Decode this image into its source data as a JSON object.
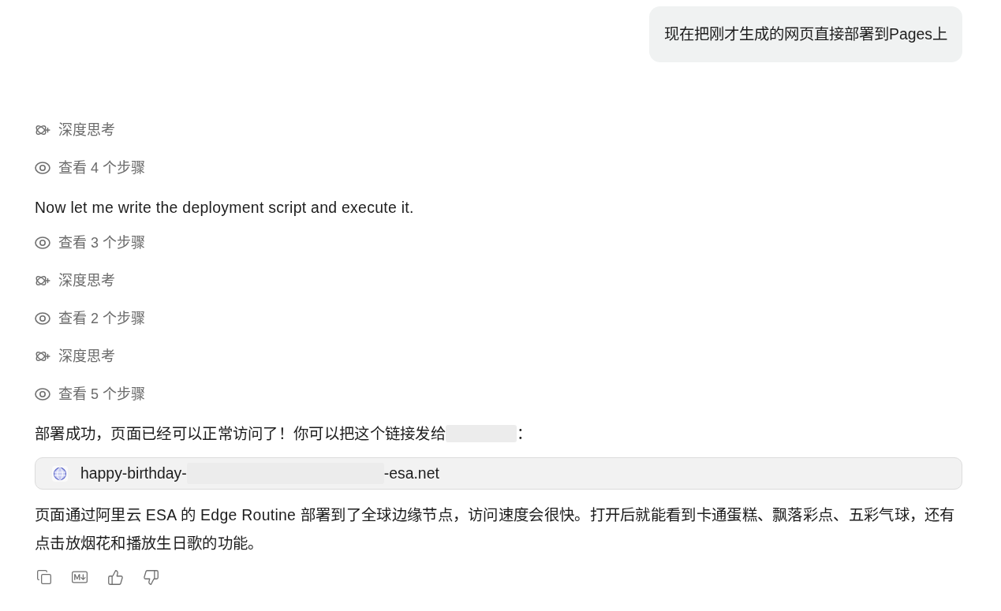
{
  "user_message": {
    "text": "现在把刚才生成的网页直接部署到Pages上"
  },
  "reply": {
    "blocks": [
      {
        "kind": "thinking",
        "label": "深度思考"
      },
      {
        "kind": "steps",
        "label": "查看 4 个步骤"
      },
      {
        "kind": "text",
        "text": "Now let me write the deployment script and execute it."
      },
      {
        "kind": "steps",
        "label": "查看 3 个步骤"
      },
      {
        "kind": "thinking",
        "label": "深度思考"
      },
      {
        "kind": "steps",
        "label": "查看 2 个步骤"
      },
      {
        "kind": "thinking",
        "label": "深度思考"
      },
      {
        "kind": "steps",
        "label": "查看 5 个步骤"
      },
      {
        "kind": "redacted_text",
        "before": "部署成功，页面已经可以正常访问了！你可以把这个链接发给",
        "after": "："
      },
      {
        "kind": "link_card",
        "prefix": "happy-birthday-",
        "suffix": "-esa.net"
      },
      {
        "kind": "text",
        "text": "页面通过阿里云 ESA 的 Edge Routine 部署到了全球边缘节点，访问速度会很快。打开后就能看到卡通蛋糕、飘落彩点、五彩气球，还有点击放烟花和播放生日歌的功能。"
      }
    ]
  }
}
